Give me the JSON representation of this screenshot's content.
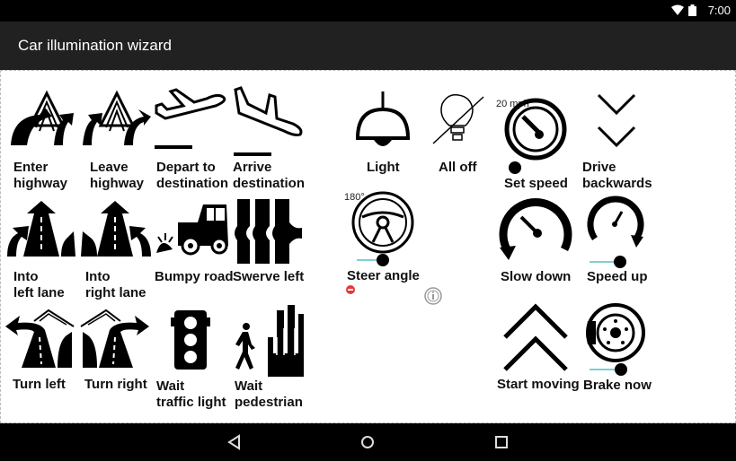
{
  "status": {
    "time": "7:00"
  },
  "app": {
    "title": "Car illumination wizard"
  },
  "tiles": {
    "enter_highway": {
      "l1": "Enter",
      "l2": "highway"
    },
    "leave_highway": {
      "l1": "Leave",
      "l2": "highway"
    },
    "depart": {
      "l1": "Depart to",
      "l2": "destination"
    },
    "arrive": {
      "l1": "Arrive",
      "l2": "destination"
    },
    "light": {
      "label": "Light"
    },
    "all_off": {
      "label": "All off"
    },
    "set_speed": {
      "label": "Set speed",
      "value": "20 mph"
    },
    "drive_backwards": {
      "l1": "Drive",
      "l2": "backwards"
    },
    "into_left_lane": {
      "l1": "Into",
      "l2": "left lane"
    },
    "into_right_lane": {
      "l1": "Into",
      "l2": "right lane"
    },
    "bumpy_road": {
      "label": "Bumpy road"
    },
    "swerve_left": {
      "label": "Swerve left"
    },
    "steer_angle": {
      "label": "Steer angle",
      "value": "180°"
    },
    "slow_down": {
      "label": "Slow down"
    },
    "speed_up": {
      "label": "Speed up"
    },
    "turn_left": {
      "label": "Turn left"
    },
    "turn_right": {
      "label": "Turn right"
    },
    "wait_light": {
      "l1": "Wait",
      "l2": "traffic light"
    },
    "wait_ped": {
      "l1": "Wait",
      "l2": "pedestrian"
    },
    "start_moving": {
      "label": "Start moving"
    },
    "brake_now": {
      "label": "Brake now"
    }
  }
}
